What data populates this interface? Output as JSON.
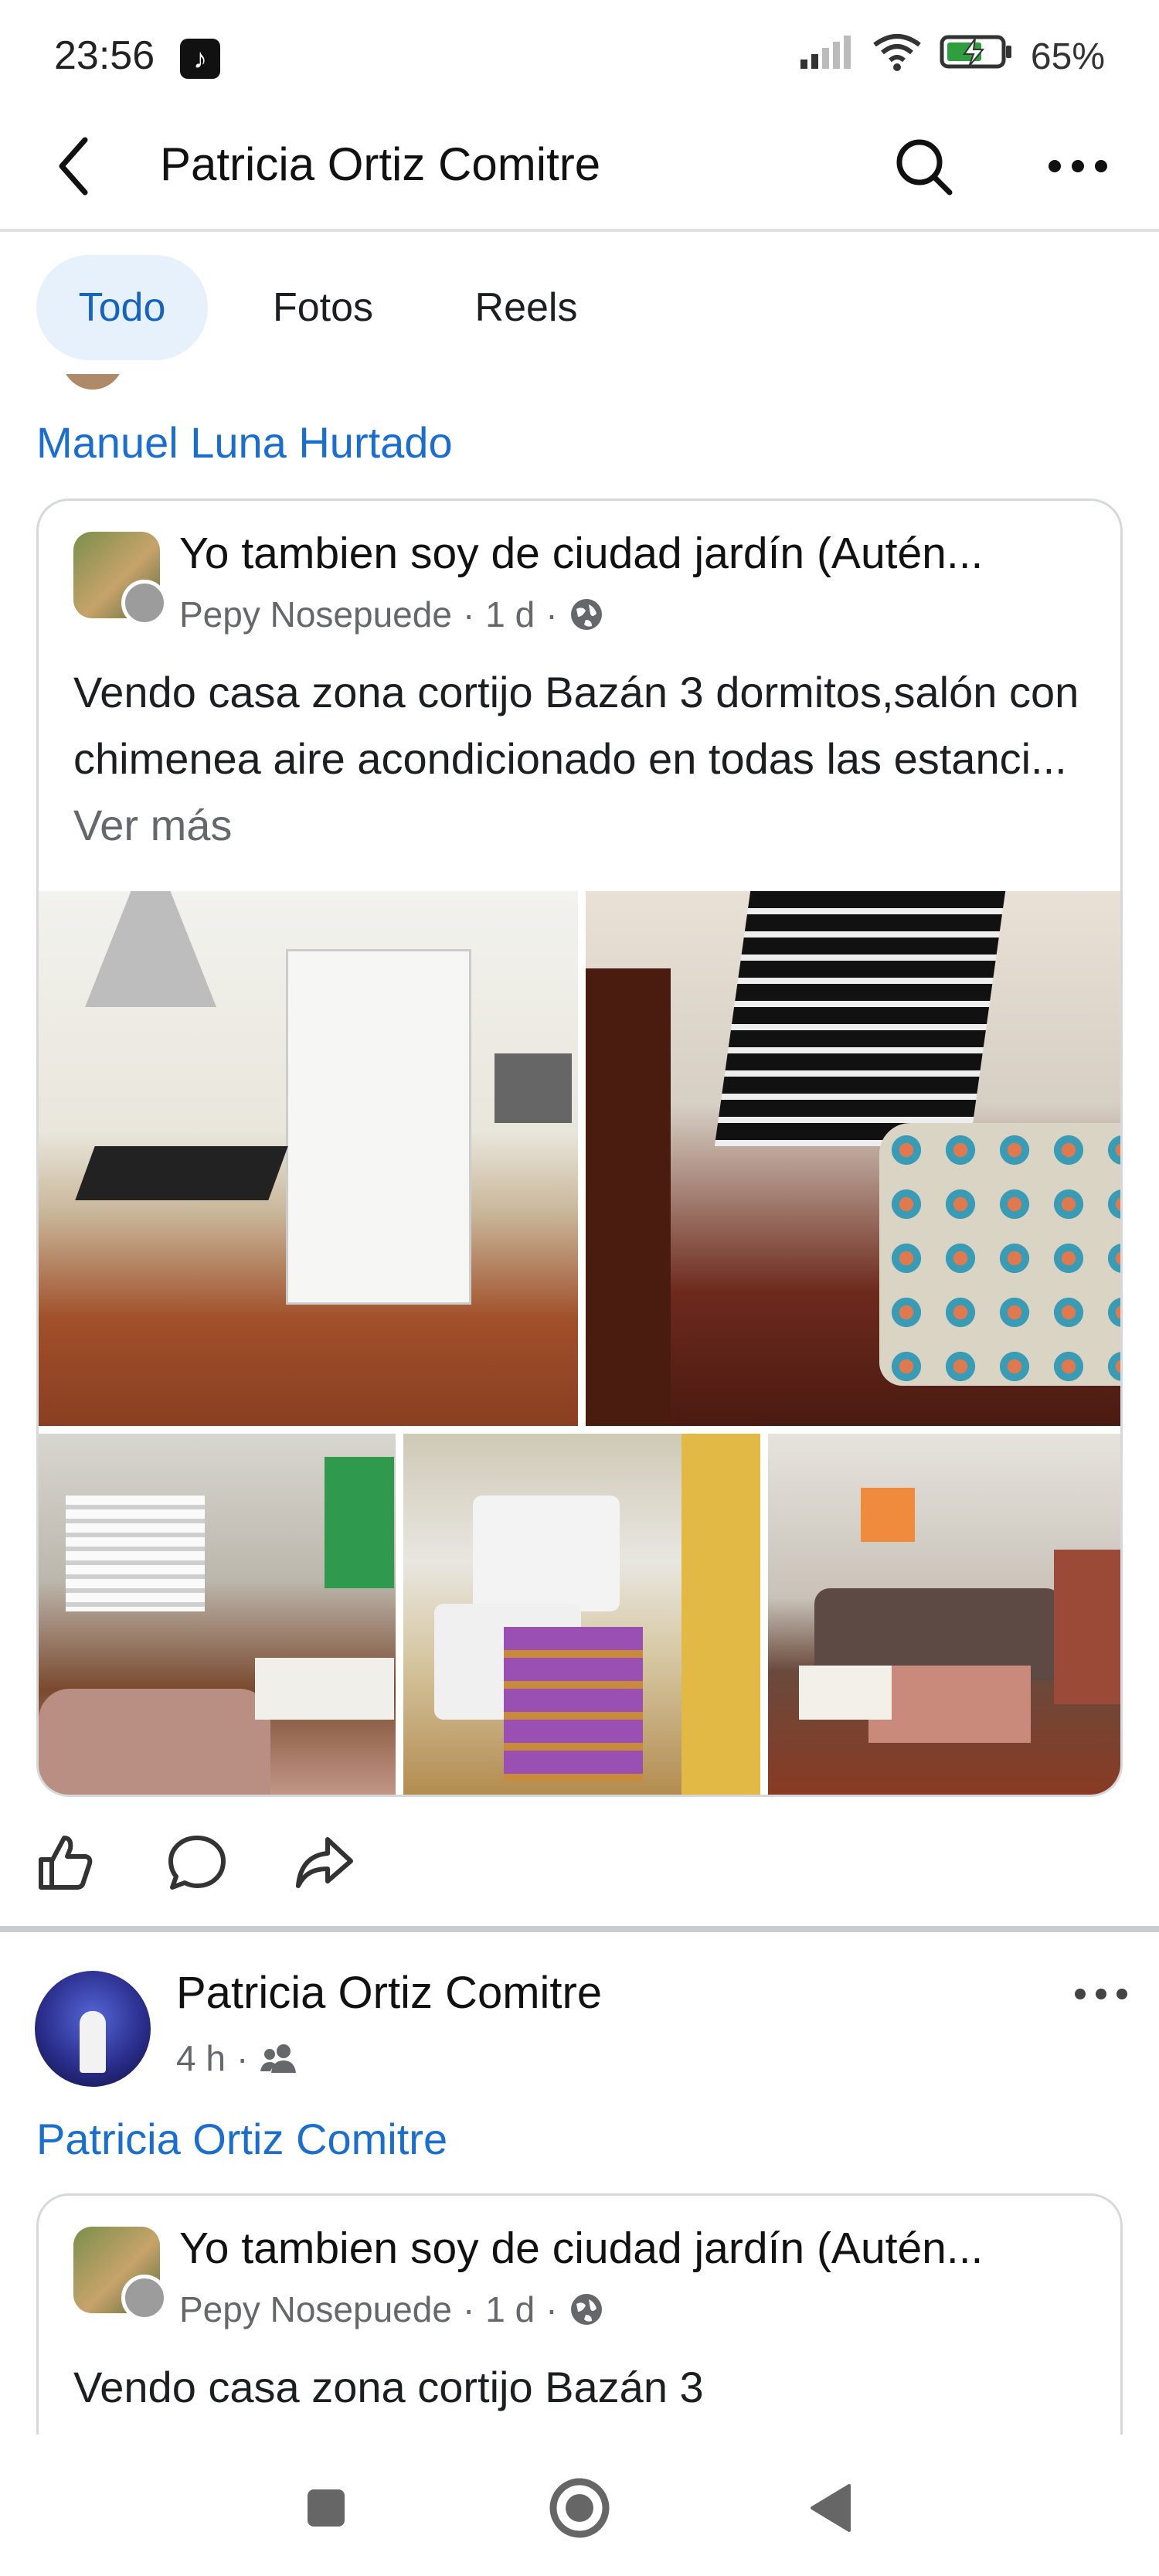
{
  "status_bar": {
    "time": "23:56",
    "app_badge_icon": "tiktok-icon",
    "battery_percent": "65%",
    "icons": [
      "signal-icon",
      "wifi-icon",
      "battery-charging-icon"
    ]
  },
  "header": {
    "back_icon": "back-arrow-icon",
    "title": "Patricia Ortiz Comitre",
    "search_icon": "search-icon",
    "more_icon": "more-horizontal-icon"
  },
  "tabs": [
    {
      "label": "Todo",
      "active": true
    },
    {
      "label": "Fotos",
      "active": false
    },
    {
      "label": "Reels",
      "active": false
    }
  ],
  "feed": {
    "shared_by_1": "Manuel Luna Hurtado",
    "post_1": {
      "group_name": "Yo tambien soy de ciudad jardín (Autén...",
      "author": "Pepy Nosepuede",
      "time": "1 d",
      "separator": "·",
      "privacy_icon": "globe-icon",
      "text": "Vendo casa zona cortijo Bazán 3 dormitos,salón con chimenea aire acondicionado en todas las estanci...",
      "see_more": "Ver más",
      "photos": [
        "kitchen-photo",
        "bedroom-photo",
        "living-room-photo",
        "laundry-photo",
        "living-room-fireplace-photo"
      ]
    },
    "actions": [
      "like-icon",
      "comment-icon",
      "share-icon"
    ],
    "post_2": {
      "author": "Patricia Ortiz Comitre",
      "time": "4 h",
      "separator": "·",
      "audience_icon": "friends-icon",
      "more_icon": "more-horizontal-icon",
      "shared_by": "Patricia Ortiz Comitre",
      "shared": {
        "group_name": "Yo tambien soy de ciudad jardín (Autén...",
        "author": "Pepy Nosepuede",
        "time": "1 d",
        "separator": "·",
        "privacy_icon": "globe-icon",
        "text": "Vendo casa zona cortijo Bazán 3"
      }
    }
  },
  "nav_bar": [
    "recent-apps-icon",
    "home-icon",
    "back-icon"
  ],
  "colors": {
    "link_blue": "#1a6ed0",
    "active_tab_bg": "#e7f1fb",
    "meta_gray": "#65676b",
    "divider": "#c9ccd1"
  }
}
